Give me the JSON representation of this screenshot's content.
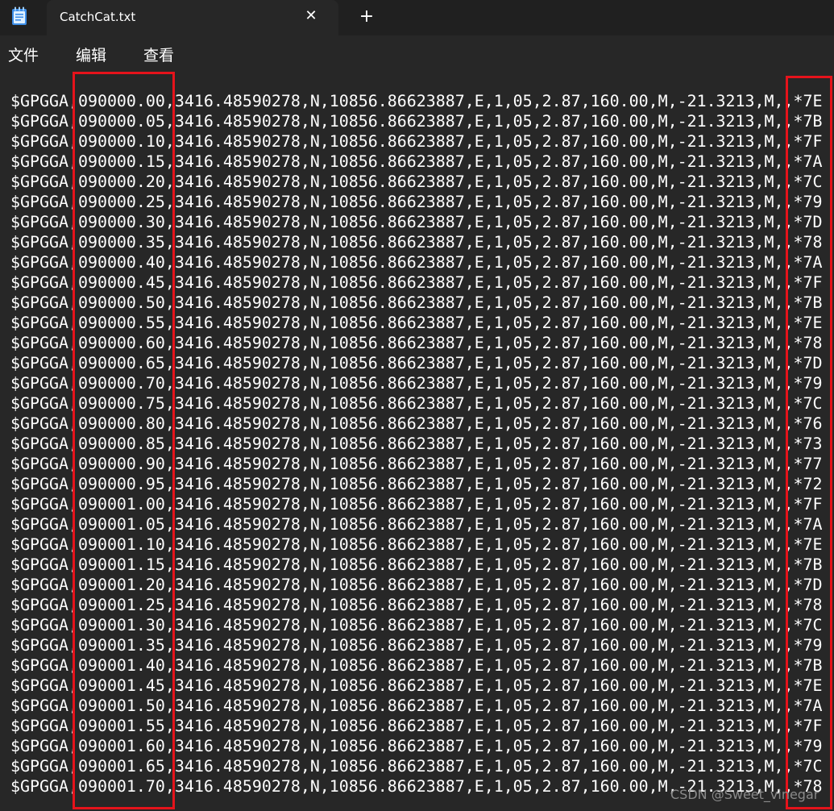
{
  "window": {
    "tab_title": "CatchCat.txt",
    "close_glyph": "✕",
    "new_tab_glyph": "+",
    "icons": {
      "app": "notepad-icon",
      "close": "close-icon",
      "new_tab": "plus-icon"
    }
  },
  "menu": {
    "items": [
      "文件",
      "编辑",
      "查看"
    ]
  },
  "editor": {
    "lines": [
      "$GPGGA,090000.00,3416.48590278,N,10856.86623887,E,1,05,2.87,160.00,M,-21.3213,M,,*7E",
      "$GPGGA,090000.05,3416.48590278,N,10856.86623887,E,1,05,2.87,160.00,M,-21.3213,M,,*7B",
      "$GPGGA,090000.10,3416.48590278,N,10856.86623887,E,1,05,2.87,160.00,M,-21.3213,M,,*7F",
      "$GPGGA,090000.15,3416.48590278,N,10856.86623887,E,1,05,2.87,160.00,M,-21.3213,M,,*7A",
      "$GPGGA,090000.20,3416.48590278,N,10856.86623887,E,1,05,2.87,160.00,M,-21.3213,M,,*7C",
      "$GPGGA,090000.25,3416.48590278,N,10856.86623887,E,1,05,2.87,160.00,M,-21.3213,M,,*79",
      "$GPGGA,090000.30,3416.48590278,N,10856.86623887,E,1,05,2.87,160.00,M,-21.3213,M,,*7D",
      "$GPGGA,090000.35,3416.48590278,N,10856.86623887,E,1,05,2.87,160.00,M,-21.3213,M,,*78",
      "$GPGGA,090000.40,3416.48590278,N,10856.86623887,E,1,05,2.87,160.00,M,-21.3213,M,,*7A",
      "$GPGGA,090000.45,3416.48590278,N,10856.86623887,E,1,05,2.87,160.00,M,-21.3213,M,,*7F",
      "$GPGGA,090000.50,3416.48590278,N,10856.86623887,E,1,05,2.87,160.00,M,-21.3213,M,,*7B",
      "$GPGGA,090000.55,3416.48590278,N,10856.86623887,E,1,05,2.87,160.00,M,-21.3213,M,,*7E",
      "$GPGGA,090000.60,3416.48590278,N,10856.86623887,E,1,05,2.87,160.00,M,-21.3213,M,,*78",
      "$GPGGA,090000.65,3416.48590278,N,10856.86623887,E,1,05,2.87,160.00,M,-21.3213,M,,*7D",
      "$GPGGA,090000.70,3416.48590278,N,10856.86623887,E,1,05,2.87,160.00,M,-21.3213,M,,*79",
      "$GPGGA,090000.75,3416.48590278,N,10856.86623887,E,1,05,2.87,160.00,M,-21.3213,M,,*7C",
      "$GPGGA,090000.80,3416.48590278,N,10856.86623887,E,1,05,2.87,160.00,M,-21.3213,M,,*76",
      "$GPGGA,090000.85,3416.48590278,N,10856.86623887,E,1,05,2.87,160.00,M,-21.3213,M,,*73",
      "$GPGGA,090000.90,3416.48590278,N,10856.86623887,E,1,05,2.87,160.00,M,-21.3213,M,,*77",
      "$GPGGA,090000.95,3416.48590278,N,10856.86623887,E,1,05,2.87,160.00,M,-21.3213,M,,*72",
      "$GPGGA,090001.00,3416.48590278,N,10856.86623887,E,1,05,2.87,160.00,M,-21.3213,M,,*7F",
      "$GPGGA,090001.05,3416.48590278,N,10856.86623887,E,1,05,2.87,160.00,M,-21.3213,M,,*7A",
      "$GPGGA,090001.10,3416.48590278,N,10856.86623887,E,1,05,2.87,160.00,M,-21.3213,M,,*7E",
      "$GPGGA,090001.15,3416.48590278,N,10856.86623887,E,1,05,2.87,160.00,M,-21.3213,M,,*7B",
      "$GPGGA,090001.20,3416.48590278,N,10856.86623887,E,1,05,2.87,160.00,M,-21.3213,M,,*7D",
      "$GPGGA,090001.25,3416.48590278,N,10856.86623887,E,1,05,2.87,160.00,M,-21.3213,M,,*78",
      "$GPGGA,090001.30,3416.48590278,N,10856.86623887,E,1,05,2.87,160.00,M,-21.3213,M,,*7C",
      "$GPGGA,090001.35,3416.48590278,N,10856.86623887,E,1,05,2.87,160.00,M,-21.3213,M,,*79",
      "$GPGGA,090001.40,3416.48590278,N,10856.86623887,E,1,05,2.87,160.00,M,-21.3213,M,,*7B",
      "$GPGGA,090001.45,3416.48590278,N,10856.86623887,E,1,05,2.87,160.00,M,-21.3213,M,,*7E",
      "$GPGGA,090001.50,3416.48590278,N,10856.86623887,E,1,05,2.87,160.00,M,-21.3213,M,,*7A",
      "$GPGGA,090001.55,3416.48590278,N,10856.86623887,E,1,05,2.87,160.00,M,-21.3213,M,,*7F",
      "$GPGGA,090001.60,3416.48590278,N,10856.86623887,E,1,05,2.87,160.00,M,-21.3213,M,,*79",
      "$GPGGA,090001.65,3416.48590278,N,10856.86623887,E,1,05,2.87,160.00,M,-21.3213,M,,*7C",
      "$GPGGA,090001.70,3416.48590278,N,10856.86623887,E,1,05,2.87,160.00,M,-21.3213,M,,*78"
    ]
  },
  "annotations": {
    "highlight_color": "#e5131b"
  },
  "watermark": {
    "text": "CSDN @Sweet_vinegar"
  }
}
